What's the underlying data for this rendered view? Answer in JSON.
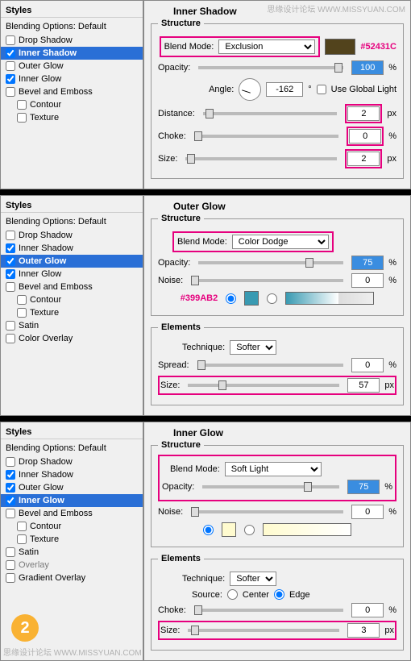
{
  "wm1": "思缘设计论坛  WWW.MISSYUAN.COM",
  "wm2": "思缘设计论坛  WWW.MISSYUAN.COM",
  "labels": {
    "styles": "Styles",
    "blending": "Blending Options: Default",
    "drop": "Drop Shadow",
    "inner": "Inner Shadow",
    "outerg": "Outer Glow",
    "innerg": "Inner Glow",
    "bevel": "Bevel and Emboss",
    "contour": "Contour",
    "texture": "Texture",
    "satin": "Satin",
    "coloroverlay": "Color Overlay",
    "gradoverlay": "Gradient Overlay",
    "structure": "Structure",
    "elements": "Elements",
    "blendmode": "Blend Mode:",
    "opacity": "Opacity:",
    "angle": "Angle:",
    "useglobal": "Use Global Light",
    "distance": "Distance:",
    "choke": "Choke:",
    "size": "Size:",
    "noise": "Noise:",
    "technique": "Technique:",
    "spread": "Spread:",
    "source": "Source:",
    "center": "Center",
    "edge": "Edge",
    "px": "px",
    "pct": "%",
    "deg": "°"
  },
  "p1": {
    "title": "Inner Shadow",
    "blend": "Exclusion",
    "colorHex": "#52431C",
    "opacity": "100",
    "angle": "-162",
    "distance": "2",
    "choke": "0",
    "size": "2"
  },
  "p2": {
    "title": "Outer Glow",
    "blend": "Color Dodge",
    "opacity": "75",
    "noise": "0",
    "colorHex": "#399AB2",
    "technique": "Softer",
    "spread": "0",
    "size": "57"
  },
  "p3": {
    "title": "Inner Glow",
    "blend": "Soft Light",
    "opacity": "75",
    "noise": "0",
    "technique": "Softer",
    "choke": "0",
    "size": "3"
  }
}
